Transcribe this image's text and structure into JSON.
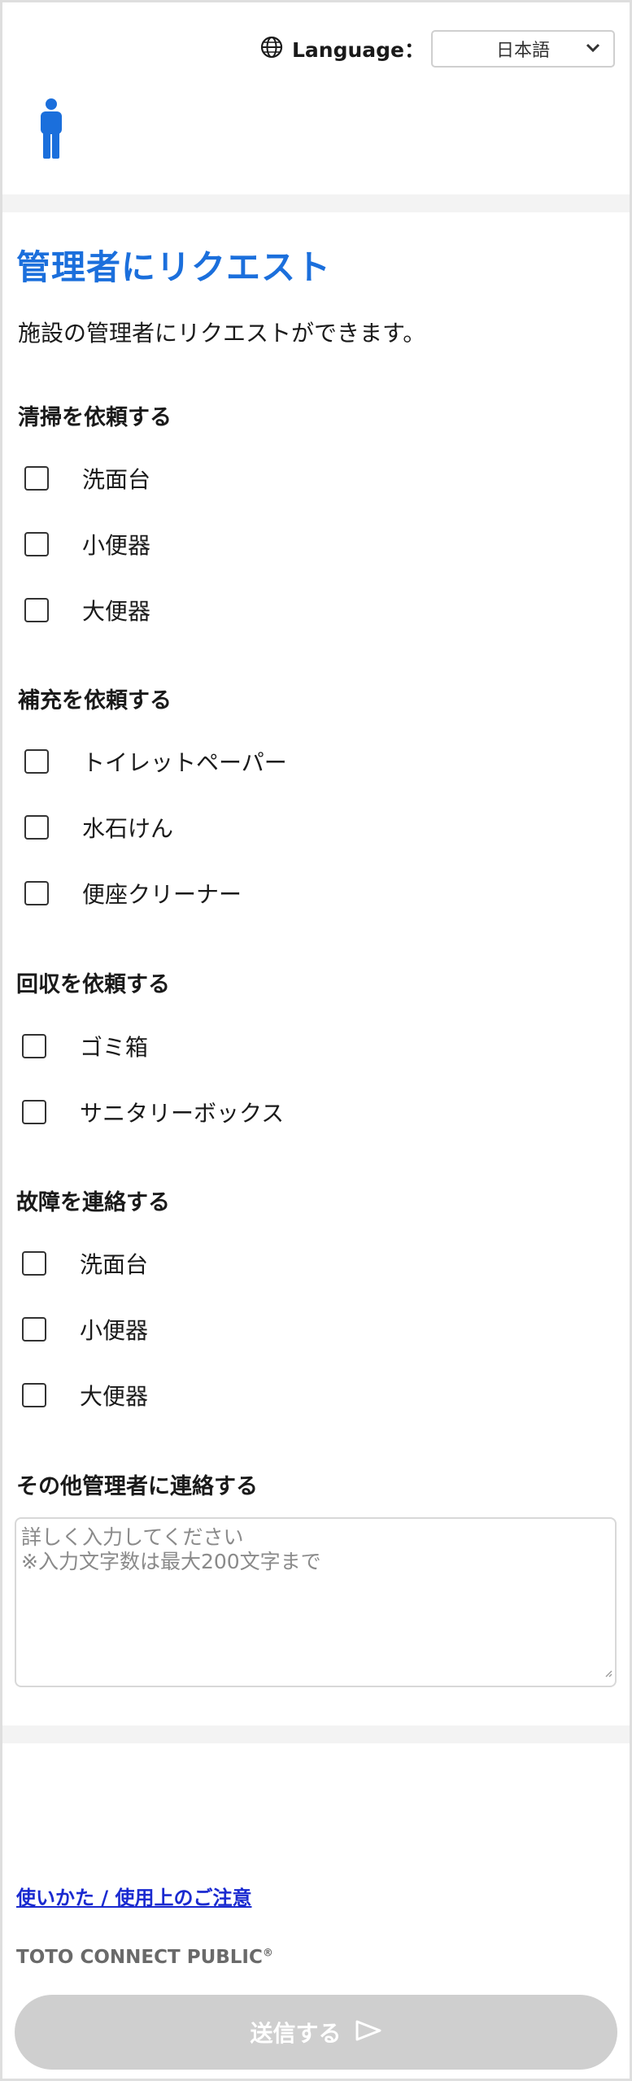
{
  "header": {
    "language_label": "Language：",
    "language_selected": "日本語"
  },
  "page": {
    "title": "管理者にリクエスト",
    "subtitle": "施設の管理者にリクエストができます。"
  },
  "sections": [
    {
      "heading": "清掃を依頼する",
      "options": [
        "洗面台",
        "小便器",
        "大便器"
      ]
    },
    {
      "heading": "補充を依頼する",
      "options": [
        "トイレットペーパー",
        "水石けん",
        "便座クリーナー"
      ]
    },
    {
      "heading": "回収を依頼する",
      "options": [
        "ゴミ箱",
        "サニタリーボックス"
      ]
    },
    {
      "heading": "故障を連絡する",
      "options": [
        "洗面台",
        "小便器",
        "大便器"
      ]
    }
  ],
  "other": {
    "heading": "その他管理者に連絡する",
    "placeholder_line1": "詳しく入力してください",
    "placeholder_line2": "※入力文字数は最大200文字まで"
  },
  "footer": {
    "usage_link": "使いかた / 使用上のご注意",
    "brand": "TOTO CONNECT PUBLIC",
    "brand_mark": "®",
    "submit_label": "送信する"
  },
  "colors": {
    "accent": "#1b6fdc",
    "link": "#1a2ad0",
    "submit_disabled": "#cfcfcf"
  },
  "icons": [
    "globe-icon",
    "chevron-down-icon",
    "person-icon",
    "send-icon"
  ]
}
